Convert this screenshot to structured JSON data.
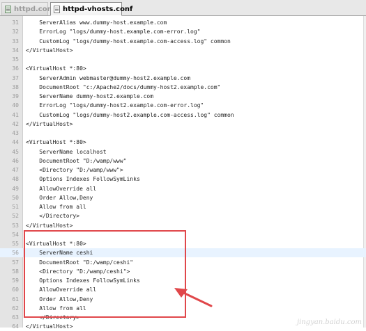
{
  "tabs": [
    {
      "label": "httpd.conf",
      "active": false
    },
    {
      "label": "httpd-vhosts.conf",
      "active": true
    }
  ],
  "editor": {
    "current_line": 56,
    "lines": [
      {
        "num": "31",
        "text": "    ServerAlias www.dummy-host.example.com"
      },
      {
        "num": "32",
        "text": "    ErrorLog \"logs/dummy-host.example.com-error.log\""
      },
      {
        "num": "33",
        "text": "    CustomLog \"logs/dummy-host.example.com-access.log\" common"
      },
      {
        "num": "34",
        "text": "</VirtualHost>"
      },
      {
        "num": "35",
        "text": ""
      },
      {
        "num": "36",
        "text": "<VirtualHost *:80>"
      },
      {
        "num": "37",
        "text": "    ServerAdmin webmaster@dummy-host2.example.com"
      },
      {
        "num": "38",
        "text": "    DocumentRoot \"c:/Apache2/docs/dummy-host2.example.com\""
      },
      {
        "num": "39",
        "text": "    ServerName dummy-host2.example.com"
      },
      {
        "num": "40",
        "text": "    ErrorLog \"logs/dummy-host2.example.com-error.log\""
      },
      {
        "num": "41",
        "text": "    CustomLog \"logs/dummy-host2.example.com-access.log\" common"
      },
      {
        "num": "42",
        "text": "</VirtualHost>"
      },
      {
        "num": "43",
        "text": ""
      },
      {
        "num": "44",
        "text": "<VirtualHost *:80>"
      },
      {
        "num": "45",
        "text": "    ServerName localhost"
      },
      {
        "num": "46",
        "text": "    DocumentRoot \"D:/wamp/www\""
      },
      {
        "num": "47",
        "text": "    <Directory \"D:/wamp/www\">"
      },
      {
        "num": "48",
        "text": "    Options Indexes FollowSymLinks"
      },
      {
        "num": "49",
        "text": "    AllowOverride all"
      },
      {
        "num": "50",
        "text": "    Order Allow,Deny"
      },
      {
        "num": "51",
        "text": "    Allow from all"
      },
      {
        "num": "52",
        "text": "    </Directory>"
      },
      {
        "num": "53",
        "text": "</VirtualHost>"
      },
      {
        "num": "54",
        "text": ""
      },
      {
        "num": "55",
        "text": "<VirtualHost *:80>"
      },
      {
        "num": "56",
        "text": "    ServerName ceshi"
      },
      {
        "num": "57",
        "text": "    DocumentRoot \"D:/wamp/ceshi\""
      },
      {
        "num": "58",
        "text": "    <Directory \"D:/wamp/ceshi\">"
      },
      {
        "num": "59",
        "text": "    Options Indexes FollowSymLinks"
      },
      {
        "num": "60",
        "text": "    AllowOverride all"
      },
      {
        "num": "61",
        "text": "    Order Allow,Deny"
      },
      {
        "num": "62",
        "text": "    Allow from all"
      },
      {
        "num": "63",
        "text": "    </Directory>"
      },
      {
        "num": "64",
        "text": "</VirtualHost>"
      }
    ]
  },
  "annotation": {
    "color": "#e0474a",
    "first_line": 55,
    "last_line": 64
  },
  "colors": {
    "gutter_bg": "#e4e4e4",
    "line_number": "#9a9a9a",
    "code_text": "#222222",
    "current_line_bg": "#e8f3ff"
  },
  "watermark": "jingyan.baidu.com"
}
